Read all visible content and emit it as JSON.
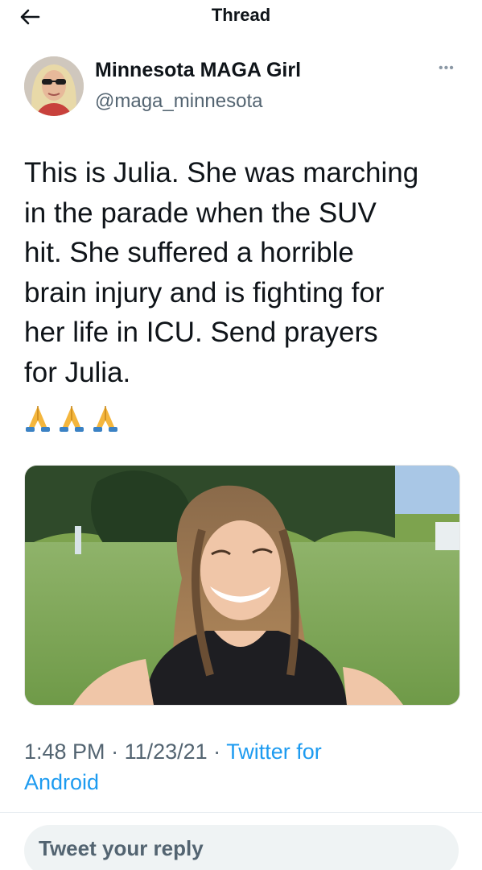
{
  "header": {
    "title": "Thread"
  },
  "author": {
    "display_name": "Minnesota MAGA Girl",
    "handle": "@maga_minnesota"
  },
  "tweet": {
    "text": "This is Julia. She was marching\nin the parade when the SUV\nhit. She suffered a horrible\nbrain injury and is fighting for\nher life in ICU. Send prayers\nfor Julia.",
    "emojis": "🙏🙏🙏"
  },
  "meta": {
    "time": "1:48 PM",
    "sep1": " · ",
    "date": "11/23/21",
    "sep2": " · ",
    "source_line1": "Twitter for",
    "source_line2": "Android"
  },
  "reply": {
    "placeholder": "Tweet your reply"
  },
  "colors": {
    "link": "#1d9bf0",
    "muted": "#536471",
    "text": "#0f1419"
  },
  "icons": {
    "back": "back-arrow-icon",
    "more": "more-options-icon",
    "prayer": "folded-hands-icon"
  }
}
